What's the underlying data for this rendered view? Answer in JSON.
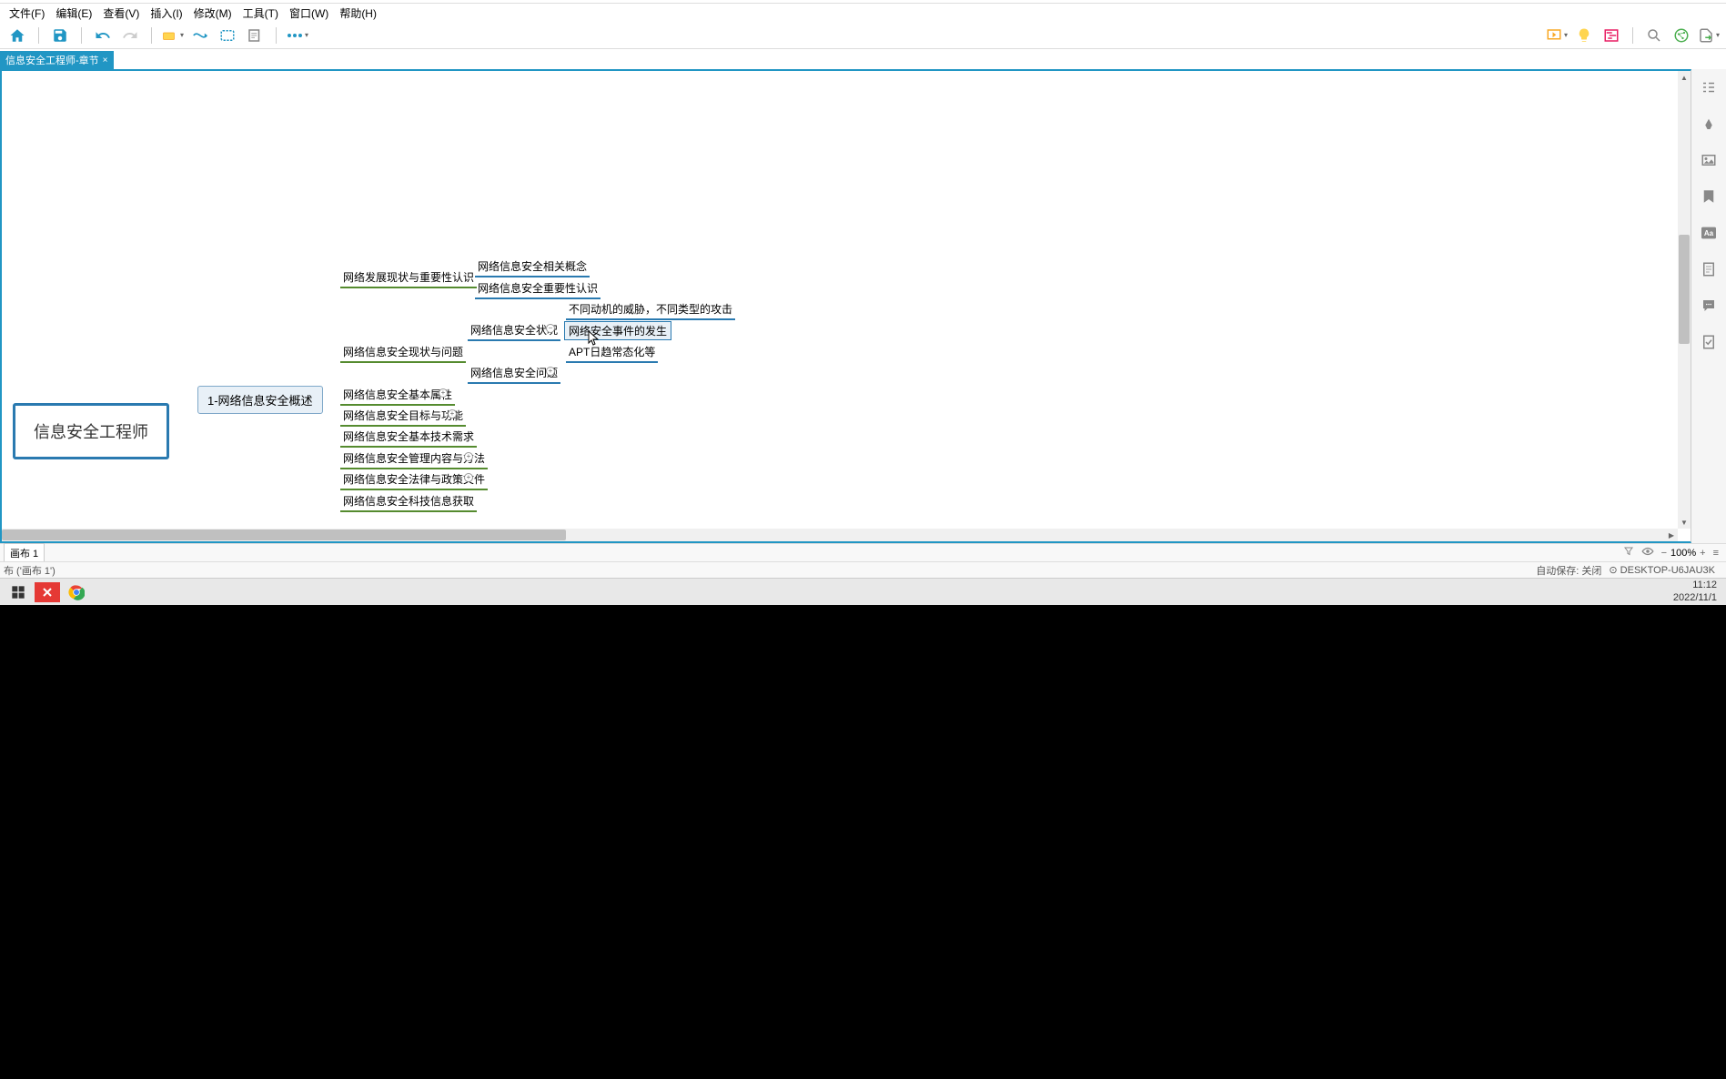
{
  "menu": {
    "file": "文件(F)",
    "edit": "编辑(E)",
    "view": "查看(V)",
    "insert": "插入(I)",
    "modify": "修改(M)",
    "tools": "工具(T)",
    "window": "窗口(W)",
    "help": "帮助(H)"
  },
  "tab": {
    "title": "信息安全工程师-章节",
    "close": "×"
  },
  "sheet": {
    "label": "画布 1"
  },
  "zoom": {
    "value": "100%",
    "filter": "⚪",
    "eye": "👁",
    "minus": "−",
    "plus": "+",
    "list": "≡"
  },
  "status": {
    "left": "布 ('画布 1')",
    "autosave": "自动保存: 关闭",
    "host": "⊙ DESKTOP-U6JAU3K"
  },
  "clock": {
    "time": "11:12",
    "date": "2022/11/1"
  },
  "mindmap": {
    "root": "信息安全工程师",
    "l1": "1-网络信息安全概述",
    "l2_1": "网络发展现状与重要性认识",
    "l2_2": "网络信息安全现状与问题",
    "l2_3": "网络信息安全基本属性",
    "l2_4": "网络信息安全目标与功能",
    "l2_5": "网络信息安全基本技术需求",
    "l2_6": "网络信息安全管理内容与方法",
    "l2_7": "网络信息安全法律与政策文件",
    "l2_8": "网络信息安全科技信息获取",
    "l3_1": "网络信息安全相关概念",
    "l3_2": "网络信息安全重要性认识",
    "l3_3": "网络信息安全状况",
    "l3_4": "网络信息安全问题",
    "l4_1": "不同动机的威胁，不同类型的攻击",
    "l4_2": "网络安全事件的发生",
    "l4_3": "APT日趋常态化等"
  },
  "chart_data": {
    "type": "mindmap",
    "title": "信息安全工程师",
    "direction": "right",
    "root": {
      "text": "信息安全工程师",
      "children": [
        {
          "text": "1-网络信息安全概述",
          "children": [
            {
              "text": "网络发展现状与重要性认识",
              "children": [
                {
                  "text": "网络信息安全相关概念"
                },
                {
                  "text": "网络信息安全重要性认识"
                }
              ]
            },
            {
              "text": "网络信息安全现状与问题",
              "children": [
                {
                  "text": "网络信息安全状况",
                  "expanded": true,
                  "children": [
                    {
                      "text": "不同动机的威胁，不同类型的攻击"
                    },
                    {
                      "text": "网络安全事件的发生",
                      "selected": true
                    },
                    {
                      "text": "APT日趋常态化等"
                    }
                  ]
                },
                {
                  "text": "网络信息安全问题",
                  "collapsed": true
                }
              ]
            },
            {
              "text": "网络信息安全基本属性",
              "collapsed": true
            },
            {
              "text": "网络信息安全目标与功能",
              "collapsed": true
            },
            {
              "text": "网络信息安全基本技术需求"
            },
            {
              "text": "网络信息安全管理内容与方法",
              "collapsed": true
            },
            {
              "text": "网络信息安全法律与政策文件",
              "collapsed": true
            },
            {
              "text": "网络信息安全科技信息获取"
            }
          ]
        }
      ]
    }
  }
}
